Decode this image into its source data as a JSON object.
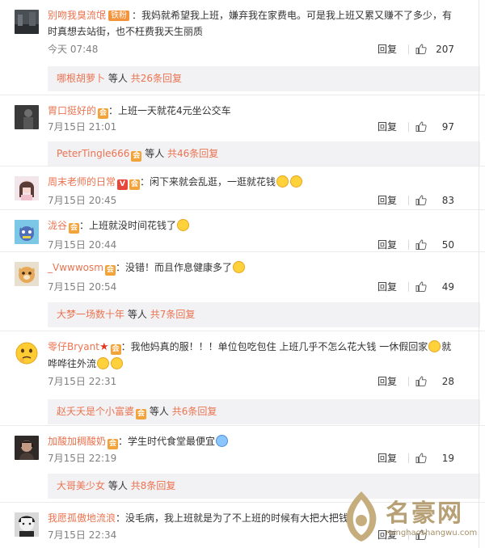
{
  "colors": {
    "username": "#eb7350",
    "subreply_bg": "#f2f2f5",
    "meta_text": "#808080"
  },
  "comments": [
    {
      "user": "别吻我臭流氓",
      "badge": "铁粉",
      "icons": [],
      "text": "：我妈就希望我上班，嫌弃我在家费电。可是我上班又累又赚不了多少，有时真想去站街，也不枉费我天生丽质",
      "emoji_after": [],
      "time": "今天 07:48",
      "reply_label": "回复",
      "likes": "207",
      "subreply": {
        "who": "哪根胡萝卜",
        "mid": "等人",
        "count": "共26条回复"
      },
      "avatar": "dark-street"
    },
    {
      "user": "胃口挺好的",
      "badge": "",
      "icons": [
        "vip-icon"
      ],
      "text": "：上班一天就花4元坐公交车",
      "emoji_after": [],
      "time": "7月15日 21:01",
      "reply_label": "回复",
      "likes": "97",
      "subreply": {
        "who": "PeterTingle666",
        "mid": "等人",
        "count": "共46条回复",
        "icons": [
          "vip-icon"
        ]
      },
      "avatar": "dark-figure"
    },
    {
      "user": "周末老师的日常",
      "badge": "",
      "icons": [
        "v-verified-icon",
        "vip-icon"
      ],
      "text": "：闲下来就会乱逛，一逛就花钱",
      "emoji_after": [
        "laugh-emoji",
        "laugh-emoji"
      ],
      "time": "7月15日 20:45",
      "reply_label": "回复",
      "likes": "83",
      "subreply": null,
      "avatar": "girl-portrait"
    },
    {
      "user": "泷谷",
      "badge": "",
      "icons": [
        "vip-icon"
      ],
      "text": "：上班就没时间花钱了",
      "emoji_after": [
        "cute-face-emoji"
      ],
      "time": "7月15日 20:44",
      "reply_label": "回复",
      "likes": "50",
      "subreply": null,
      "avatar": "cartoon-cat"
    },
    {
      "user": "_Vwwwosm",
      "badge": "",
      "icons": [
        "vip-icon"
      ],
      "text": "：没错！而且作息健康多了",
      "emoji_after": [
        "figure-emoji"
      ],
      "time": "7月15日 20:54",
      "reply_label": "回复",
      "likes": "49",
      "subreply": {
        "who": "大梦一场数十年",
        "mid": "等人",
        "count": "共7条回复"
      },
      "avatar": "orange-cat"
    },
    {
      "user": "零仔Bryant",
      "badge": "",
      "icons": [
        "star-icon",
        "vip-icon"
      ],
      "text": "：我他妈真的服！！！单位包吃包住 上班几乎不怎么花大钱 一休假回家",
      "text2": "就哗哗往外流",
      "emoji_after": [
        "money-bag-emoji"
      ],
      "emoji_end": [
        "sweat-emoji",
        "sweat-emoji"
      ],
      "time": "7月15日 22:31",
      "reply_label": "回复",
      "likes": "28",
      "subreply": {
        "who": "赵夭夭是个小富婆",
        "mid": "等人",
        "count": "共6条回复",
        "icons": [
          "vip-icon"
        ]
      },
      "avatar": "thinking-emoji-face"
    },
    {
      "user": "加酸加稠酸奶",
      "badge": "",
      "icons": [
        "vip-icon"
      ],
      "text": "：学生时代食堂最便宜",
      "emoji_after": [
        "crying-emoji"
      ],
      "time": "7月15日 22:19",
      "reply_label": "回复",
      "likes": "19",
      "subreply": {
        "who": "大哥美少女",
        "mid": "等人",
        "count": "共8条回复"
      },
      "avatar": "dark-girl"
    },
    {
      "user": "我愿孤傲地流浪",
      "badge": "",
      "icons": [],
      "text": "：没毛病，我上班就是为了不上班的时候有大把大把钱",
      "emoji_after": [],
      "time": "7月15日 22:34",
      "reply_label": "回复",
      "likes": "",
      "subreply": null,
      "avatar": "bw-face"
    }
  ],
  "watermark": {
    "title": "名豪网",
    "url": "minghaoshangwu.com"
  }
}
